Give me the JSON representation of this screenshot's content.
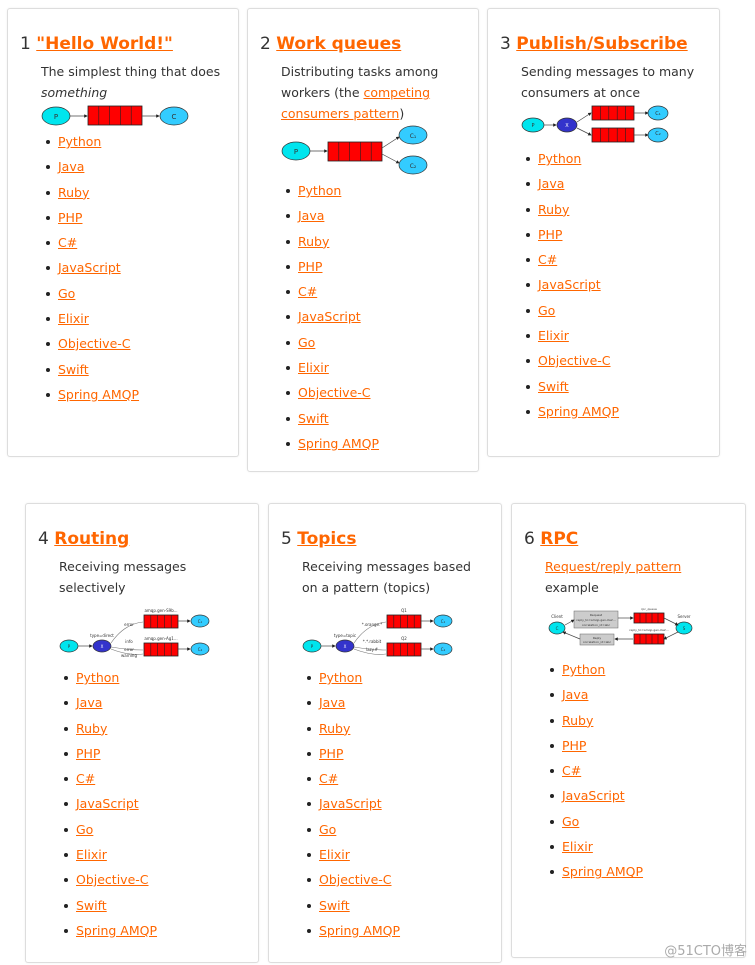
{
  "colors": {
    "accent": "#ff6600",
    "queue": "#ff0000",
    "producer": "#00e5ee",
    "consumer": "#33ccff",
    "exchange": "#3333cc"
  },
  "tutorials": [
    {
      "num": "1",
      "title": "\"Hello World!\"",
      "desc": [
        {
          "t": "The simplest thing that does "
        },
        {
          "t": "something",
          "i": true
        }
      ],
      "diagram": "hello",
      "labels": {
        "p": "P",
        "c": "C"
      },
      "links": [
        "Python",
        "Java",
        "Ruby",
        "PHP",
        "C#",
        "JavaScript",
        "Go",
        "Elixir",
        "Objective-C",
        "Swift",
        "Spring AMQP"
      ]
    },
    {
      "num": "2",
      "title": "Work queues",
      "desc": [
        {
          "t": "Distributing tasks among workers (the "
        },
        {
          "t": "competing consumers pattern",
          "a": true
        },
        {
          "t": ")"
        }
      ],
      "diagram": "work",
      "labels": {
        "p": "P",
        "c1": "C₁",
        "c2": "C₂"
      },
      "links": [
        "Python",
        "Java",
        "Ruby",
        "PHP",
        "C#",
        "JavaScript",
        "Go",
        "Elixir",
        "Objective-C",
        "Swift",
        "Spring AMQP"
      ]
    },
    {
      "num": "3",
      "title": "Publish/Subscribe",
      "desc": [
        {
          "t": "Sending messages to many consumers at once"
        }
      ],
      "diagram": "pubsub",
      "labels": {
        "p": "P",
        "x": "X",
        "c1": "C₁",
        "c2": "C₂"
      },
      "links": [
        "Python",
        "Java",
        "Ruby",
        "PHP",
        "C#",
        "JavaScript",
        "Go",
        "Elixir",
        "Objective-C",
        "Swift",
        "Spring AMQP"
      ]
    },
    {
      "num": "4",
      "title": "Routing",
      "desc": [
        {
          "t": "Receiving messages selectively"
        }
      ],
      "diagram": "routing",
      "labels": {
        "p": "P",
        "x": "X",
        "type": "type=direct",
        "q1": "amqp.gen-S9b...",
        "q2": "amqp.gen-Ag1...",
        "e1": "error",
        "e2": "info",
        "e3": "error",
        "e4": "warning",
        "c1": "C₁",
        "c2": "C₂"
      },
      "links": [
        "Python",
        "Java",
        "Ruby",
        "PHP",
        "C#",
        "JavaScript",
        "Go",
        "Elixir",
        "Objective-C",
        "Swift",
        "Spring AMQP"
      ]
    },
    {
      "num": "5",
      "title": "Topics",
      "desc": [
        {
          "t": "Receiving messages based on a pattern (topics)"
        }
      ],
      "diagram": "topics",
      "labels": {
        "p": "P",
        "x": "X",
        "type": "type=topic",
        "q1": "Q1",
        "q2": "Q2",
        "e1": "*.orange.*",
        "e2": "*.*.rabbit",
        "e3": "lazy.#",
        "c1": "C₁",
        "c2": "C₂"
      },
      "links": [
        "Python",
        "Java",
        "Ruby",
        "PHP",
        "C#",
        "JavaScript",
        "Go",
        "Elixir",
        "Objective-C",
        "Swift",
        "Spring AMQP"
      ]
    },
    {
      "num": "6",
      "title": "RPC",
      "desc": [
        {
          "t": "Request/reply pattern",
          "a": true
        },
        {
          "t": " example"
        }
      ],
      "diagram": "rpc",
      "labels": {
        "client": "Client",
        "server": "Server",
        "c": "C",
        "s": "S",
        "rq": "rpc_queue",
        "rp": "reply_to=amqp.gen-Xa2...",
        "req1": "Request",
        "req2": "reply_to=amqp.gen-Xa2...",
        "req3": "correlation_id=abc",
        "rep1": "Reply",
        "rep2": "correlation_id=abc"
      },
      "links": [
        "Python",
        "Java",
        "Ruby",
        "PHP",
        "C#",
        "JavaScript",
        "Go",
        "Elixir",
        "Spring AMQP"
      ]
    }
  ],
  "watermark": "@51CTO博客"
}
